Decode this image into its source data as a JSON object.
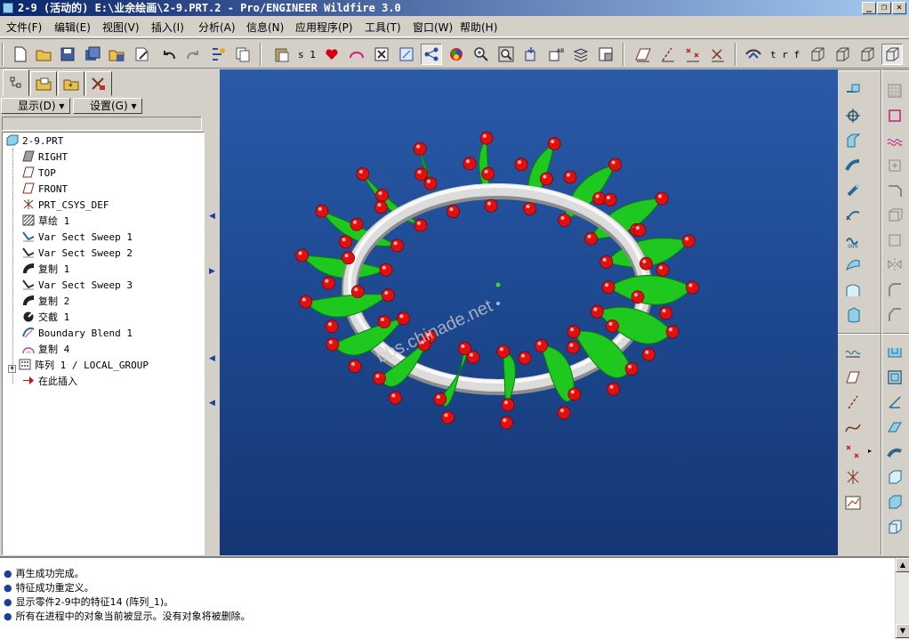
{
  "window": {
    "title": "2-9 (活动的) E:\\业余绘画\\2-9.PRT.2 - Pro/ENGINEER Wildfire 3.0",
    "buttons": [
      "_",
      "❐",
      "✕"
    ]
  },
  "menu": [
    "文件(F)",
    "编辑(E)",
    "视图(V)",
    "插入(I)",
    "分析(A)",
    "信息(N)",
    "应用程序(P)",
    "工具(T)",
    "窗口(W)",
    "帮助(H)"
  ],
  "toolbar": {
    "text_s1": "s 1",
    "text_trf": "t r f"
  },
  "left_panel": {
    "show_label": "显示(D)",
    "settings_label": "设置(G)",
    "tree": [
      {
        "label": "2-9.PRT",
        "icon": "part-icon"
      },
      {
        "label": "RIGHT",
        "icon": "datum-plane-icon"
      },
      {
        "label": "TOP",
        "icon": "datum-plane-icon"
      },
      {
        "label": "FRONT",
        "icon": "datum-plane-icon"
      },
      {
        "label": "PRT_CSYS_DEF",
        "icon": "csys-icon"
      },
      {
        "label": "草绘 1",
        "icon": "sketch-icon"
      },
      {
        "label": "Var Sect Sweep 1",
        "icon": "sweep-icon"
      },
      {
        "label": "Var Sect Sweep 2",
        "icon": "sweep-icon"
      },
      {
        "label": "复制 1",
        "icon": "copy-icon"
      },
      {
        "label": "Var Sect Sweep 3",
        "icon": "sweep-icon"
      },
      {
        "label": "复制 2",
        "icon": "copy-icon"
      },
      {
        "label": "交截 1",
        "icon": "intersect-icon"
      },
      {
        "label": "Boundary Blend 1",
        "icon": "blend-icon"
      },
      {
        "label": "复制 4",
        "icon": "copy-icon"
      },
      {
        "label": "阵列 1 / LOCAL_GROUP",
        "icon": "pattern-icon"
      },
      {
        "label": "在此插入",
        "icon": "insert-here-icon"
      }
    ]
  },
  "viewport": {
    "watermark": "bbs.chinade.net"
  },
  "messages": [
    "再生成功完成。",
    "特征成功重定义。",
    "显示零件2-9中的特征14 (阵列_1)。",
    "所有在进程中的对象当前被显示。没有对象将被删除。"
  ],
  "colors": {
    "viewport_top": "#2a5aa8",
    "viewport_bottom": "#153674",
    "green": "#1ec81e",
    "red": "#e01010",
    "ring": "#d8d8d8"
  }
}
